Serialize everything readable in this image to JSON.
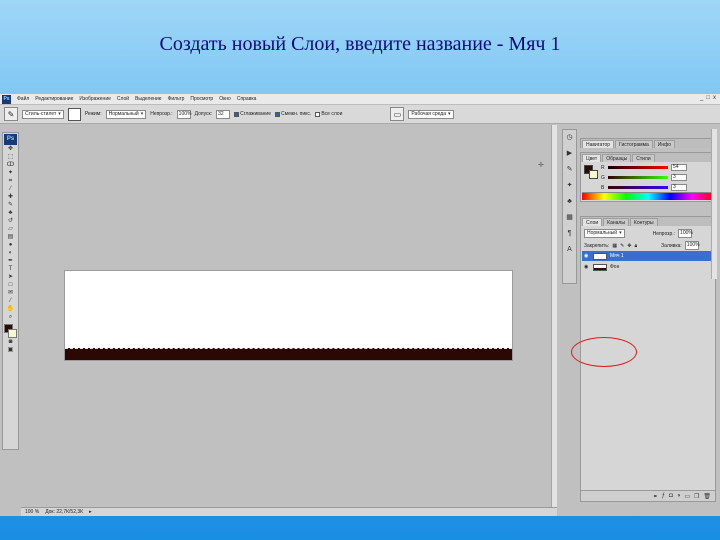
{
  "slide": {
    "title": "Создать новый Слои, введите название - Мяч 1"
  },
  "app": {
    "logo": "Ps",
    "menu": [
      "Файл",
      "Редактирование",
      "Изображение",
      "Слой",
      "Выделение",
      "Фильтр",
      "Просмотр",
      "Окно",
      "Справка"
    ],
    "window_controls": [
      "_",
      "□",
      "x"
    ]
  },
  "options_bar": {
    "tool_icon": "brush-icon",
    "preset": "Стиль-стилет",
    "mode_label": "Режим:",
    "mode_value": "Нормальный",
    "opacity_label": "Непрозр.:",
    "opacity_value": "100%",
    "tolerance_label": "Допуск:",
    "tolerance_value": "32",
    "antialias_label": "Сглаживание",
    "contiguous_label": "Смежн. пикс.",
    "all_layers_label": "Все слои",
    "workspace_label": "Рабочая среда"
  },
  "colors": {
    "foreground": "#2b0c05",
    "background": "#fafad2",
    "layer_selected": "#3a6fcf",
    "highlight": "#e01b1b"
  },
  "status": {
    "zoom": "100 %",
    "doc_info": "Док: 22,7К/52,3К"
  },
  "panels": {
    "navigator_tabs": [
      "Навигатор",
      "Гистограмма",
      "Инфо"
    ],
    "color_tabs": [
      "Цвет",
      "Образцы",
      "Стили"
    ],
    "color_values": {
      "r": "54",
      "g": "3",
      "b": "3"
    },
    "layers_tabs": [
      "Слои",
      "Каналы",
      "Контуры"
    ],
    "blend_mode": "Нормальный",
    "opacity_label": "Непрозр.:",
    "opacity_value": "100%",
    "lock_label": "Закрепить:",
    "fill_label": "Заливка:",
    "fill_value": "100%",
    "layers": [
      {
        "name": "Мяч 1",
        "selected": true
      },
      {
        "name": "Фон",
        "selected": false
      }
    ]
  }
}
